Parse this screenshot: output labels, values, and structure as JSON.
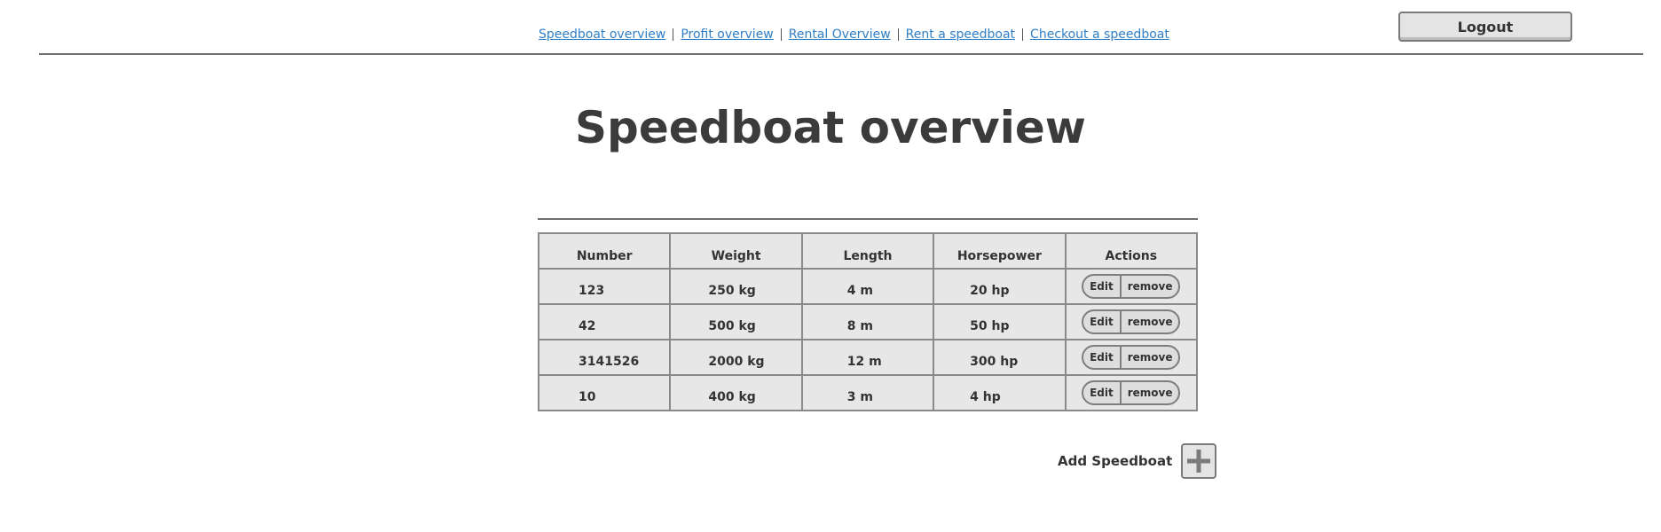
{
  "nav": {
    "links": [
      "Speedboat overview",
      "Profit overview",
      "Rental Overview",
      "Rent a speedboat",
      "Checkout a speedboat"
    ],
    "logout_label": "Logout"
  },
  "page": {
    "title": "Speedboat overview"
  },
  "table": {
    "headers": [
      "Number",
      "Weight",
      "Length",
      "Horsepower",
      "Actions"
    ],
    "rows": [
      {
        "number": "123",
        "weight": "250 kg",
        "length": "4 m",
        "horsepower": "20 hp"
      },
      {
        "number": "42",
        "weight": "500 kg",
        "length": "8 m",
        "horsepower": "50 hp"
      },
      {
        "number": "3141526",
        "weight": "2000 kg",
        "length": "12 m",
        "horsepower": "300 hp"
      },
      {
        "number": "10",
        "weight": "400 kg",
        "length": "3 m",
        "horsepower": "4 hp"
      }
    ],
    "edit_label": "Edit",
    "remove_label": "remove"
  },
  "add": {
    "label": "Add Speedboat",
    "icon": "plus-icon"
  }
}
